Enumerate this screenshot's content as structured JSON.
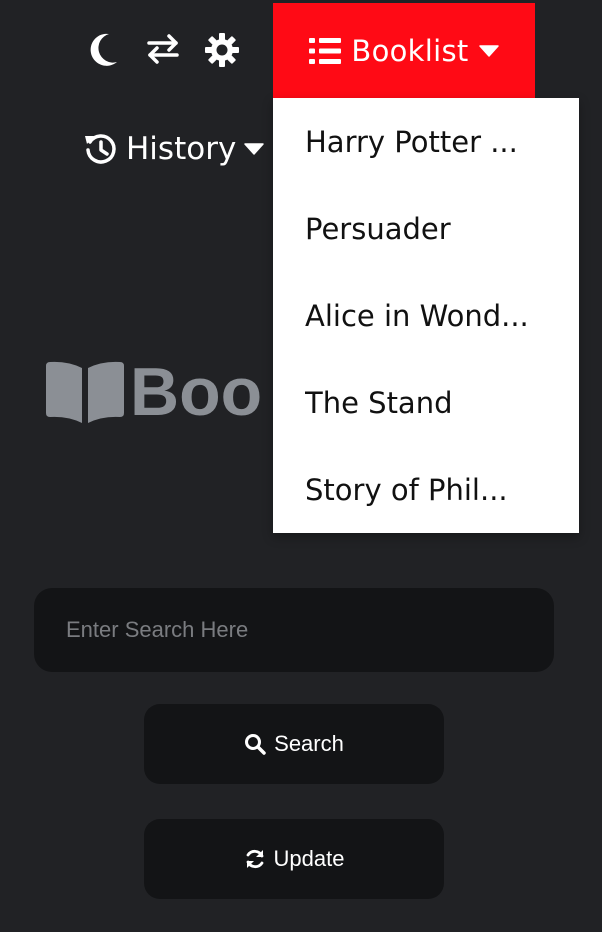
{
  "toolbar": {
    "theme_icon": "moon-icon",
    "swap_icon": "swap-arrows-icon",
    "settings_icon": "gear-icon"
  },
  "booklist": {
    "label": "Booklist",
    "icon": "list-icon",
    "caret_icon": "caret-down-icon",
    "accent": "#ff0a15",
    "items": [
      "Harry Potter ...",
      "Persuader",
      "Alice in Wond...",
      "The Stand",
      "Story of Phil..."
    ]
  },
  "history": {
    "label": "History",
    "icon": "history-icon",
    "caret_icon": "caret-down-icon"
  },
  "logo": {
    "text": "Boo",
    "icon": "book-icon"
  },
  "search": {
    "placeholder": "Enter Search Here",
    "value": ""
  },
  "buttons": {
    "search_label": "Search",
    "search_icon": "search-icon",
    "update_label": "Update",
    "update_icon": "refresh-icon"
  }
}
